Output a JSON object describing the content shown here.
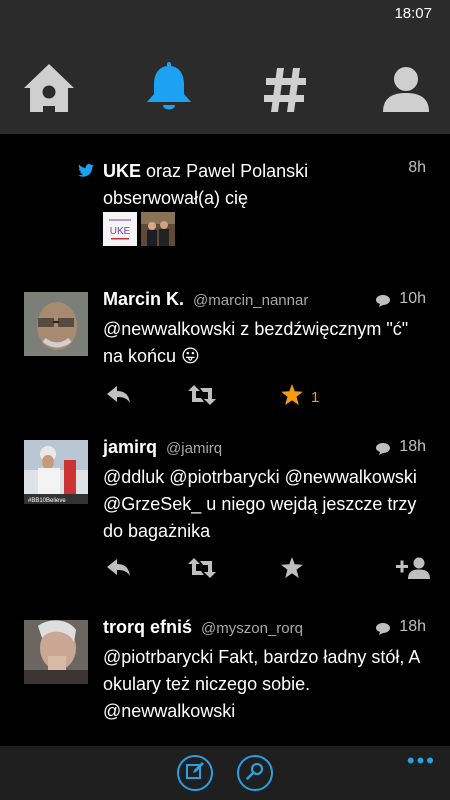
{
  "status_bar": {
    "time": "18:07"
  },
  "nav_tabs": [
    {
      "name": "home",
      "icon": "home-icon",
      "active": false
    },
    {
      "name": "notifications",
      "icon": "bell-icon",
      "active": true
    },
    {
      "name": "discover",
      "icon": "hashtag-icon",
      "active": false
    },
    {
      "name": "profile",
      "icon": "person-icon",
      "active": false
    }
  ],
  "colors": {
    "accent": "#1da1f2",
    "favorite": "#f39c12",
    "bar_bg": "#2b2b2b",
    "appbar_bg": "#1f1f1f"
  },
  "notification": {
    "icon": "twitter-bird-icon",
    "actor_name": "UKE",
    "joiner": "oraz",
    "actor2": "Pawel Polanski",
    "action": "obserwował(a) cię",
    "time": "8h",
    "thumb1_text": "UKE"
  },
  "tweets": [
    {
      "name": "Marcin K.",
      "handle": "@marcin_nannar",
      "time": "10h",
      "text": "@newwalkowski z bezdźwięcznym \"ć\" na końcu 😛",
      "favorite_count": "1"
    },
    {
      "name": "jamirq",
      "handle": "@jamirq",
      "time": "18h",
      "text": "@ddluk @piotrbarycki @newwalkowski @GrzeSek_ u niego wejdą jeszcze trzy do bagażnika",
      "avatar_tag": "#BB10Believe"
    },
    {
      "name": "trorq efniś",
      "handle": "@myszon_rorq",
      "time": "18h",
      "text": "@piotrbarycki Fakt, bardzo ładny stół, A okulary też niczego sobie. @newwalkowski"
    }
  ],
  "app_bar": {
    "more_label": "•••"
  }
}
